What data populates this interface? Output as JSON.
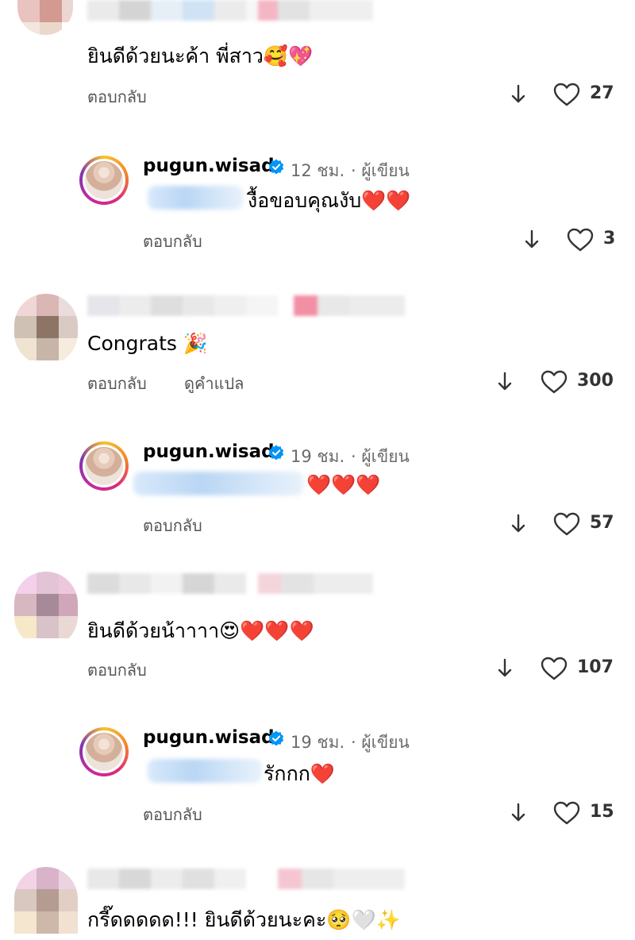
{
  "comments": [
    {
      "text": "ยินดีด้วยนะค้า พี่สาว🥰💖",
      "reply_label": "ตอบกลับ",
      "likes": "27",
      "reply": {
        "username": "pugun.wisad",
        "time": "12 ชม.",
        "author_tag": "· ผู้เขียน",
        "text": "งื้อขอบคุณงับ❤️❤️",
        "reply_label": "ตอบกลับ",
        "likes": "3"
      }
    },
    {
      "text": "Congrats 🎉",
      "reply_label": "ตอบกลับ",
      "translate_label": "ดูคำแปล",
      "likes": "300",
      "reply": {
        "username": "pugun.wisad",
        "time": "19 ชม.",
        "author_tag": "· ผู้เขียน",
        "text": "❤️❤️❤️",
        "reply_label": "ตอบกลับ",
        "likes": "57"
      }
    },
    {
      "text": "ยินดีด้วยน้าาาา😍❤️❤️❤️",
      "reply_label": "ตอบกลับ",
      "likes": "107",
      "reply": {
        "username": "pugun.wisad",
        "time": "19 ชม.",
        "author_tag": "· ผู้เขียน",
        "text": "รักกก❤️",
        "reply_label": "ตอบกลับ",
        "likes": "15"
      }
    },
    {
      "text": "กรี๊ดดดดด!!! ยินดีด้วยนะคะ🥺🤍✨"
    }
  ],
  "colors": {
    "verified": "#0095f6",
    "meta_text": "#6b6b6b",
    "action_text": "#555555"
  },
  "icons": [
    "down-arrow-icon",
    "heart-icon",
    "verified-badge-icon"
  ]
}
